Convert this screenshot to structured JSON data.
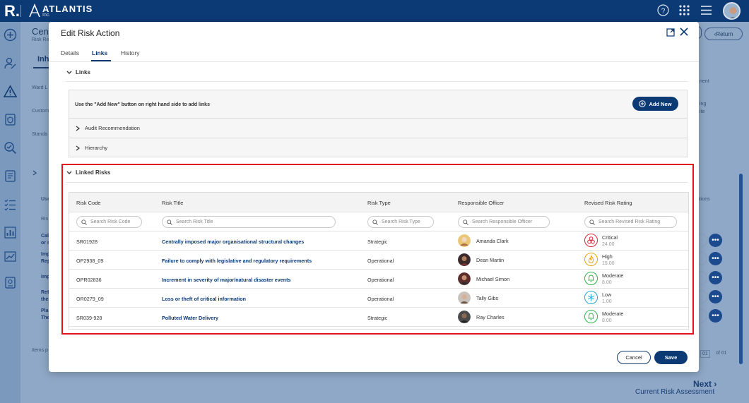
{
  "app": {
    "brand_letter": "R.",
    "brand_name": "ATLANTIS",
    "brand_sub": "Inc."
  },
  "background": {
    "title": "Cent",
    "subtitle": "Risk Re",
    "tab": "Inhe",
    "return_label": "Return",
    "labels": [
      "Ward L",
      "Custom",
      "Standa"
    ],
    "right_snippets": [
      "nent",
      "ing",
      "ite",
      "utions"
    ],
    "left_list": [
      "Use",
      "Ris",
      "Cal",
      "or r",
      "Imp",
      "Rep",
      "Imp",
      "Ret",
      "the",
      "Pla",
      "The"
    ],
    "items_label": "Items p",
    "pager": [
      "01",
      "of 01"
    ],
    "next_label": "Next",
    "next_sub": "Current Risk Assessment"
  },
  "modal": {
    "title": "Edit Risk Action",
    "tabs": [
      "Details",
      "Links",
      "History"
    ],
    "active_tab": "Links",
    "links_section": {
      "heading": "Links",
      "hint": "Use the \"Add New\" button on right hand side to add links",
      "add_new_label": "Add New",
      "subsections": [
        "Audit Recommendation",
        "Hierarchy"
      ]
    },
    "linked_risks": {
      "heading": "Linked Risks",
      "columns": [
        "Risk Code",
        "Risk Title",
        "Risk Type",
        "Responsible Officer",
        "Revised Risk Rating"
      ],
      "filter_placeholders": [
        "Search Risk Code",
        "Search Risk Title",
        "Search Risk Type",
        "Search Responsible Officer",
        "Search Revised Risk Rating"
      ],
      "rows": [
        {
          "code": "SR01928",
          "title": "Centrally imposed major organisational structural changes",
          "type": "Strategic",
          "officer": "Amanda Clark",
          "rating": "Critical",
          "score": "24.00"
        },
        {
          "code": "OP2938_09",
          "title": "Failure to comply with legislative and regulatory requirements",
          "type": "Operational",
          "officer": "Dean Martin",
          "rating": "High",
          "score": "15.00"
        },
        {
          "code": "OPR02836",
          "title": "Increment in severity of major/natural disaster events",
          "type": "Operational",
          "officer": "Michael Simon",
          "rating": "Moderate",
          "score": "8.00"
        },
        {
          "code": "OR0279_09",
          "title": "Loss or theft of critical information",
          "type": "Operational",
          "officer": "Tally Gibs",
          "rating": "Low",
          "score": "1.00"
        },
        {
          "code": "SR039-928",
          "title": "Polluted Water Delivery",
          "type": "Strategic",
          "officer": "Ray Charles",
          "rating": "Moderate",
          "score": "8.00"
        }
      ]
    },
    "footer": {
      "cancel_label": "Cancel",
      "save_label": "Save"
    }
  },
  "colors": {
    "primary": "#0c3a75",
    "critical": "#d9263a",
    "high": "#e8a317",
    "moderate": "#2fb34a",
    "low": "#22a7d8",
    "highlight_frame": "#e0141c"
  },
  "icons": [
    "help-icon",
    "apps-grid-icon",
    "hamburger-menu-icon",
    "plus-circle-icon",
    "user-edit-icon",
    "warning-icon",
    "shield-doc-icon",
    "search-check-icon",
    "document-icon",
    "checklist-icon",
    "bar-chart-icon",
    "trend-chart-icon",
    "report-icon",
    "expand-icon",
    "close-icon",
    "chevron-down-icon",
    "chevron-right-icon",
    "add-circle-icon",
    "search-icon",
    "more-dots-icon"
  ]
}
